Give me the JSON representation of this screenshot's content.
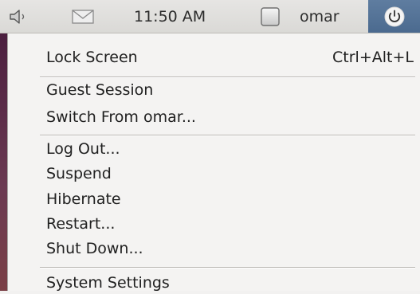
{
  "panel": {
    "clock": "11:50 AM",
    "username": "omar",
    "icons": {
      "volume": "speaker-icon",
      "mail": "envelope-icon",
      "user": "user-status-icon",
      "session": "power-icon"
    },
    "accent_color": "#4b6a8f"
  },
  "menu": {
    "lock_screen": {
      "label": "Lock Screen",
      "shortcut": "Ctrl+Alt+L"
    },
    "guest_session": "Guest Session",
    "switch_user": "Switch From omar...",
    "log_out": "Log Out...",
    "suspend": "Suspend",
    "hibernate": "Hibernate",
    "restart": "Restart...",
    "shut_down": "Shut Down...",
    "system_settings": "System Settings"
  }
}
